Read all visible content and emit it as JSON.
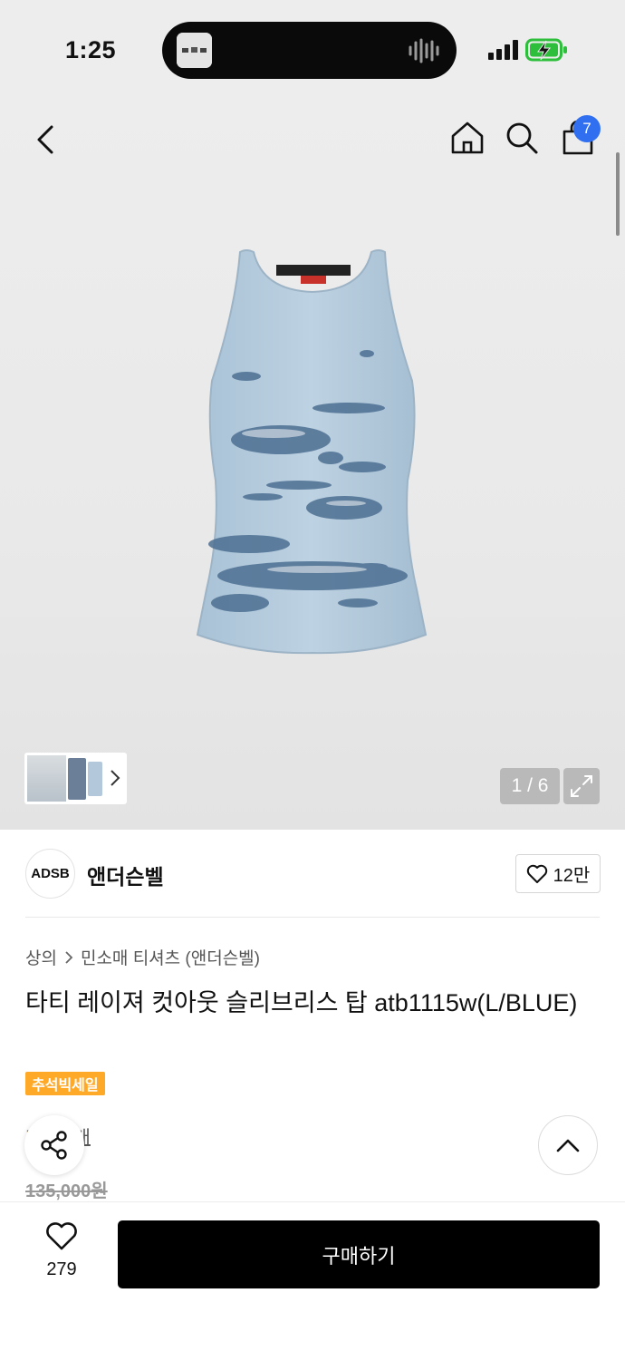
{
  "status_bar": {
    "time": "1:25"
  },
  "header": {
    "cart_count": "7"
  },
  "gallery": {
    "counter": "1 / 6"
  },
  "brand": {
    "logo_text": "ADSB",
    "name": "앤더슨벨",
    "likes": "12만"
  },
  "product": {
    "breadcrumb": [
      "상의",
      "민소매 티셔츠 (앤더슨벨)"
    ],
    "title": "타티 레이져 컷아웃 슬리브리스 탑 atb1115w(L/BLUE)",
    "sale_badge": "추석빅세일",
    "reviews": "후기 4개",
    "original_price": "135,000원"
  },
  "bottom_bar": {
    "wish_count": "279",
    "buy_label": "구매하기"
  },
  "colors": {
    "badge_blue": "#2f6ff0",
    "sale_orange": "#ffa928",
    "buy_black": "#000000"
  }
}
